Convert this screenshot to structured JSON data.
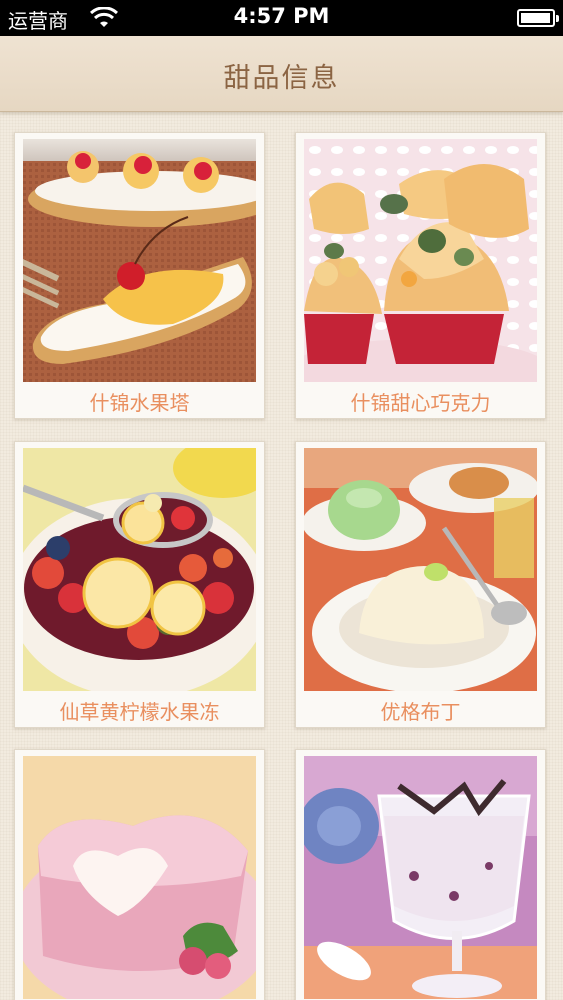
{
  "status_bar": {
    "carrier": "运营商",
    "time": "4:57 PM",
    "battery_level": 0.95
  },
  "nav": {
    "title": "甜品信息"
  },
  "desserts": [
    {
      "name": "什锦水果塔",
      "image": "fruit-tart-photo"
    },
    {
      "name": "什锦甜心巧克力",
      "image": "chocolate-cups-photo"
    },
    {
      "name": "仙草黄柠檬水果冻",
      "image": "lemon-fruit-jelly-photo"
    },
    {
      "name": "优格布丁",
      "image": "yogurt-pudding-photo"
    },
    {
      "name": "",
      "image": "heart-mousse-photo"
    },
    {
      "name": "",
      "image": "parfait-glass-photo"
    }
  ]
}
